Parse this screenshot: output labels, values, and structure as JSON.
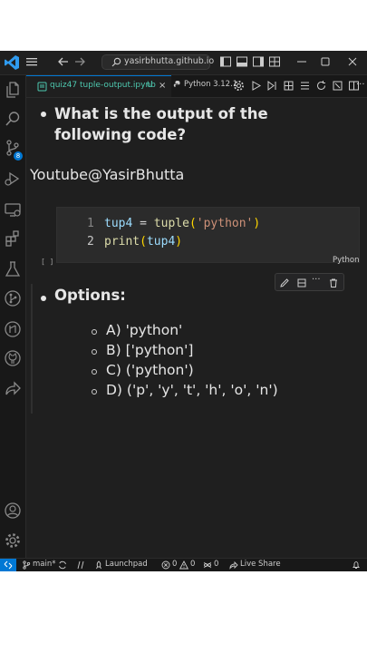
{
  "titlebar": {
    "search_text": "yasirbhutta.github.io"
  },
  "activity": {
    "scm_badge": "8"
  },
  "tabs": {
    "active": {
      "name": "quiz47 tuple-output.ipynb",
      "flag": "U",
      "close": "×"
    },
    "kernel": "Python 3.12.1"
  },
  "notebook": {
    "question": "What is the output of the following code?",
    "channel": "Youtube@YasirBhutta",
    "code_lines": [
      {
        "num": "1",
        "a": "tup4 = tuple(",
        "s": "'python'",
        "b": ")"
      },
      {
        "num": "2",
        "a": "print(tup4)",
        "s": "",
        "b": ""
      }
    ],
    "language": "Python",
    "exec_count": "[ ]",
    "options_title": "Options:",
    "options": [
      "A) 'python'",
      "B) ['python']",
      "C) ('python')",
      "D) ('p', 'y', 't', 'h', 'o', 'n')"
    ]
  },
  "statusbar": {
    "branch": "main*",
    "launchpad": "Launchpad",
    "errors": "0",
    "warnings": "0",
    "ports": "0",
    "liveshare": "Live Share"
  },
  "colors": {
    "accent": "#0078d4",
    "keyword_blue": "#9cdcfe",
    "function_yellow": "#dcdcaa",
    "string_orange": "#ce9178"
  }
}
